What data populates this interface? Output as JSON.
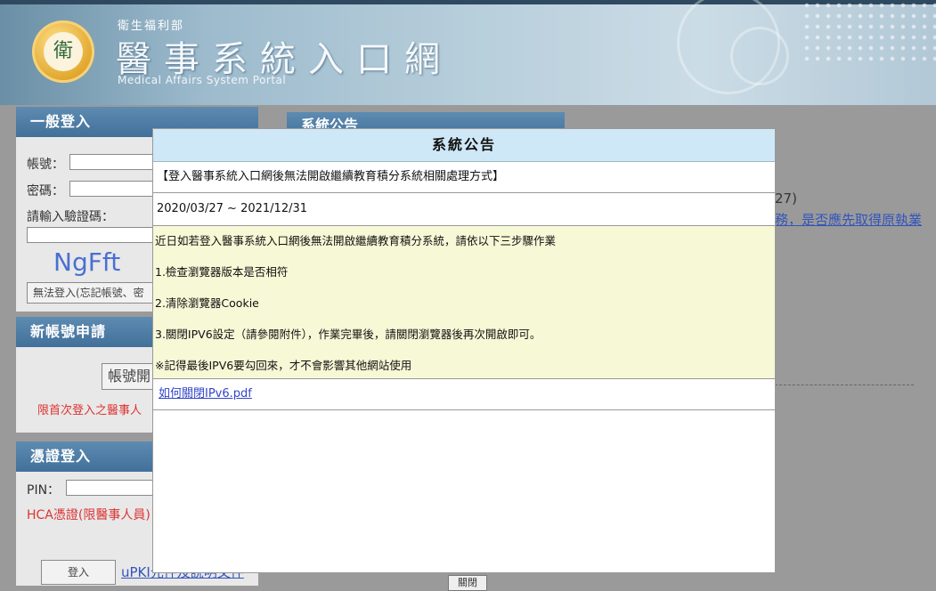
{
  "header": {
    "ministry": "衛生福利部",
    "title": "醫事系統入口網",
    "subtitle": "Medical Affairs System Portal",
    "logo_text": "衛"
  },
  "general_login": {
    "heading": "一般登入",
    "account_label": "帳號：",
    "password_label": "密碼：",
    "captcha_label": "請輸入驗證碼：",
    "captcha_code": "NgFft",
    "forgot_label": "無法登入(忘記帳號、密"
  },
  "new_account": {
    "heading": "新帳號申請",
    "button_label": "帳號開",
    "note": "限首次登入之醫事人"
  },
  "cert_login": {
    "heading": "憑證登入",
    "pin_label": "PIN：",
    "hca_note": "HCA憑證(限醫事人員)",
    "login_button": "登入",
    "upki_link": "uPKI元件及說明文件"
  },
  "bg_announcements": {
    "heading": "系統公告",
    "date_fragment": "27)",
    "link_fragment": "務，是否應先取得原執業",
    "close_button": "關閉"
  },
  "modal": {
    "title": "系統公告",
    "subject": "【登入醫事系統入口網後無法開啟繼續教育積分系統相關處理方式】",
    "period": "2020/03/27 ~ 2021/12/31",
    "lines": [
      "近日如若登入醫事系統入口網後無法開啟繼續教育積分系統，請依以下三步驟作業",
      "1.檢查瀏覽器版本是否相符",
      "2.清除瀏覽器Cookie",
      "3.關閉IPV6設定（請參閱附件），作業完畢後，請關閉瀏覽器後再次開啟即可。",
      "※記得最後IPV6要勾回來，才不會影響其他網站使用"
    ],
    "attachment": "如何關閉IPv6.pdf"
  },
  "colors": {
    "panel_header": "#4a7aa3",
    "modal_title_bg": "#cfe8f7",
    "modal_body_bg": "#f7f8d6",
    "warning_text": "#dd3333"
  }
}
